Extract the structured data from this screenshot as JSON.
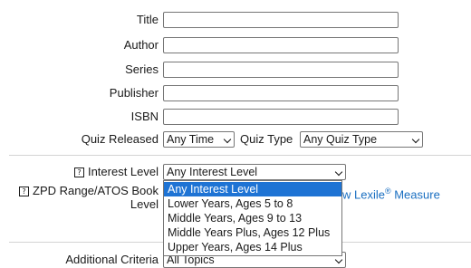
{
  "fields": {
    "title_label": "Title",
    "author_label": "Author",
    "series_label": "Series",
    "publisher_label": "Publisher",
    "isbn_label": "ISBN",
    "title_value": "",
    "author_value": "",
    "series_value": "",
    "publisher_value": "",
    "isbn_value": ""
  },
  "quiz": {
    "released_label": "Quiz Released",
    "released_value": "Any Time",
    "type_label": "Quiz Type",
    "type_value": "Any Quiz Type"
  },
  "interest": {
    "help_glyph": "?",
    "label": "Interest Level",
    "value": "Any Interest Level",
    "options": [
      "Any Interest Level",
      "Lower Years, Ages 5 to 8",
      "Middle Years, Ages 9 to 13",
      "Middle Years Plus, Ages 12 Plus",
      "Upper Years, Ages 14 Plus"
    ],
    "highlighted_index": 0
  },
  "zpd": {
    "help_glyph": "?",
    "label_line1": "ZPD Range/ATOS Book",
    "label_line2": "Level",
    "lexile_link_prefix": "w Lexile",
    "lexile_sup": "®",
    "lexile_link_suffix": " Measure"
  },
  "additional": {
    "label": "Additional Criteria",
    "value": "All Topics"
  },
  "colors": {
    "link": "#1a6fc1",
    "highlight": "#1e73d4"
  }
}
